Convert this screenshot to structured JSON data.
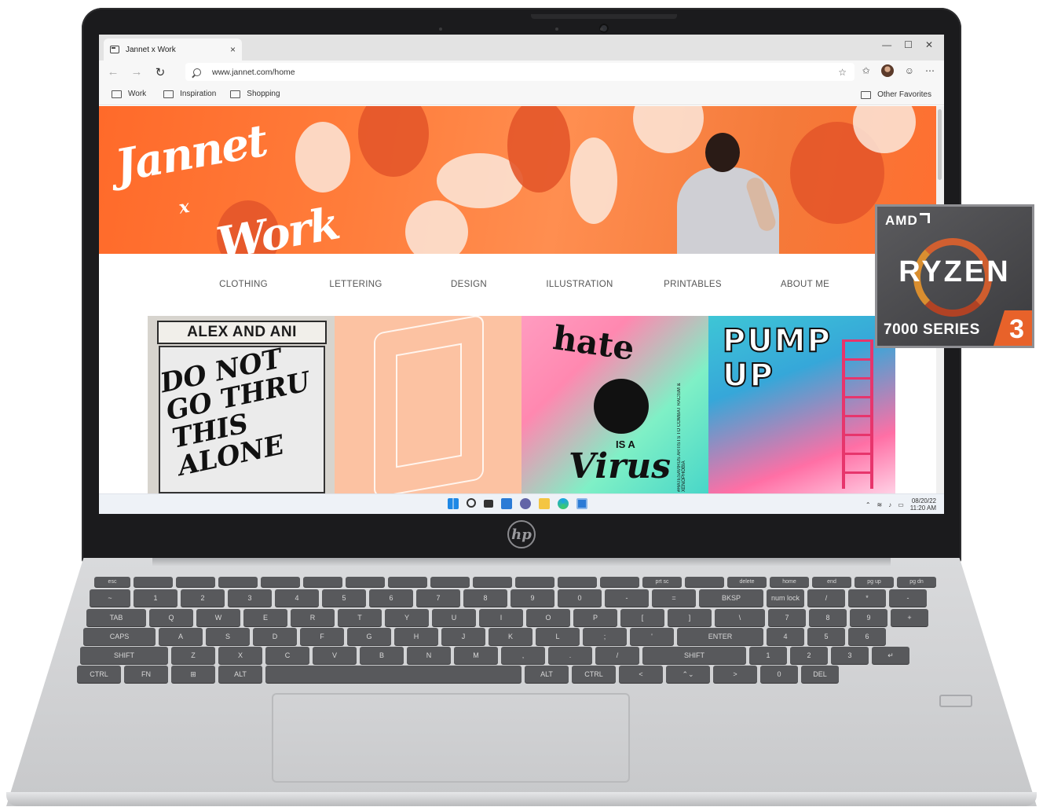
{
  "browser": {
    "tab_title": "Jannet x Work",
    "tab_close": "×",
    "url": "www.jannet.com/home",
    "favorites": [
      "Work",
      "Inspiration",
      "Shopping"
    ],
    "other_favorites": "Other Favorites",
    "window_controls": [
      "—",
      "☐",
      "✕"
    ]
  },
  "site": {
    "logo_line1": "Jannet",
    "logo_x": "x",
    "logo_line2": "Work",
    "nav": [
      "CLOTHING",
      "LETTERING",
      "DESIGN",
      "ILLUSTRATION",
      "PRINTABLES",
      "ABOUT ME"
    ],
    "tiles": {
      "t1_sign": "ALEX AND ANI",
      "t1_art": "DO NOT GO THRU THIS ALONE",
      "t3_word1": "hate",
      "t3_isa": "IS A",
      "t3_word2": "Virus",
      "t3_side": "#HATESAVIRUS ARTISTS TO COMBAT RACISM & XENOPHOBIA",
      "t4_text": "PUMP UP"
    }
  },
  "taskbar": {
    "date": "08/20/22",
    "time": "11:20 AM"
  },
  "badge": {
    "brand": "AMD",
    "name": "RYZEN",
    "series": "7000 SERIES",
    "tier": "3"
  },
  "device": {
    "logo": "hp"
  },
  "keyboard": {
    "fn_row": [
      "esc",
      "",
      "",
      "",
      "",
      "",
      "",
      "",
      "",
      "",
      "",
      "",
      "",
      "prt sc",
      "",
      "delete",
      "home",
      "end",
      "pg up",
      "pg dn"
    ],
    "row1": [
      "~",
      "1",
      "2",
      "3",
      "4",
      "5",
      "6",
      "7",
      "8",
      "9",
      "0",
      "-",
      "=",
      "BKSP",
      "num lock",
      "/",
      "*",
      "-"
    ],
    "row2": [
      "TAB",
      "Q",
      "W",
      "E",
      "R",
      "T",
      "Y",
      "U",
      "I",
      "O",
      "P",
      "[",
      "]",
      "\\",
      "7",
      "8",
      "9",
      "+"
    ],
    "row3": [
      "CAPS",
      "A",
      "S",
      "D",
      "F",
      "G",
      "H",
      "J",
      "K",
      "L",
      ";",
      "'",
      "ENTER",
      "4",
      "5",
      "6"
    ],
    "row4": [
      "SHIFT",
      "Z",
      "X",
      "C",
      "V",
      "B",
      "N",
      "M",
      ",",
      ".",
      "/",
      "SHIFT",
      "1",
      "2",
      "3",
      "↵"
    ],
    "row5": [
      "CTRL",
      "FN",
      "⊞",
      "ALT",
      "",
      "ALT",
      "CTRL",
      "<",
      "⌃⌄",
      ">",
      "0",
      "DEL"
    ]
  },
  "colors": {
    "hero_orange": "#ff6a2a",
    "amd_orange": "#e8622a",
    "bezel": "#1b1b1d",
    "chassis": "#cfd0d2",
    "keycap": "#58595c"
  }
}
